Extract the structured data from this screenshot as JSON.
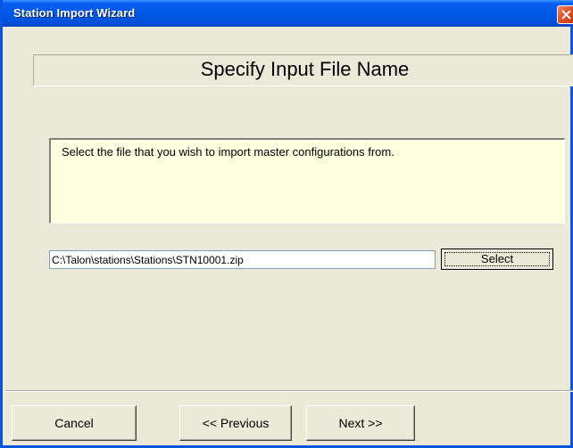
{
  "window": {
    "title": "Station Import Wizard",
    "accent": "#0058e6"
  },
  "header": {
    "title": "Specify Input File Name"
  },
  "description": {
    "text": "Select the file that you wish to import master configurations from."
  },
  "file": {
    "path": "C:\\Talon\\stations\\Stations\\STN10001.zip",
    "select_label": "Select"
  },
  "footer": {
    "cancel_label": "Cancel",
    "previous_label": "<< Previous",
    "next_label": "Next >>"
  },
  "icons": {
    "close": "close-icon"
  }
}
